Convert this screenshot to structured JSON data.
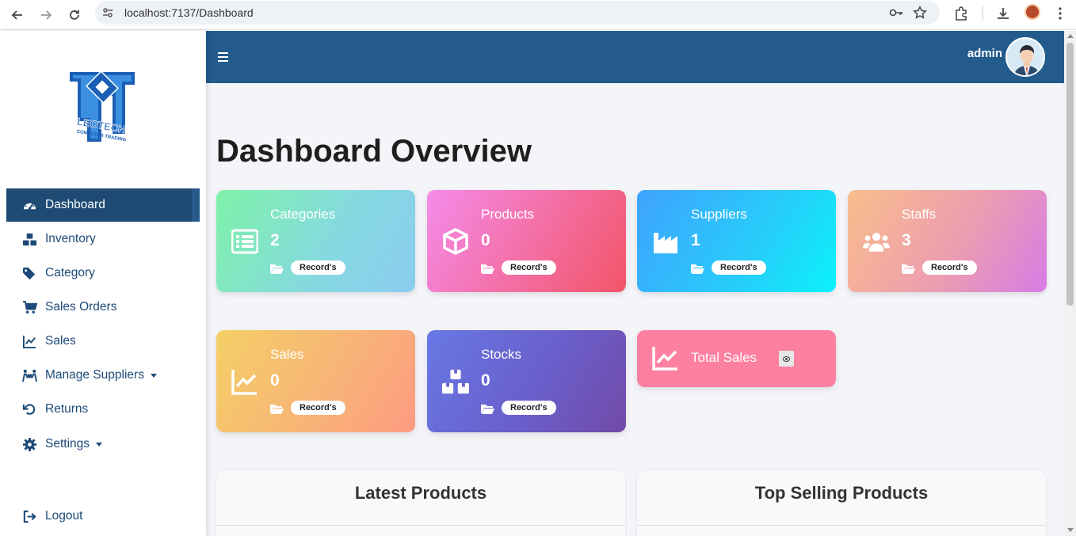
{
  "browser": {
    "url": "localhost:7137/Dashboard"
  },
  "sidebar": {
    "logo_text": "LEOTECH COMPUTER TRADING",
    "items": [
      {
        "label": "Dashboard",
        "icon": "gauge-icon",
        "active": true
      },
      {
        "label": "Inventory",
        "icon": "boxes-icon"
      },
      {
        "label": "Category",
        "icon": "tags-icon"
      },
      {
        "label": "Sales Orders",
        "icon": "cart-icon"
      },
      {
        "label": "Sales",
        "icon": "chart-line-icon"
      },
      {
        "label": "Manage Suppliers",
        "icon": "people-carry-icon",
        "dropdown": true
      },
      {
        "label": "Returns",
        "icon": "undo-icon"
      },
      {
        "label": "Settings",
        "icon": "gear-icon",
        "dropdown": true
      }
    ],
    "logout": {
      "label": "Logout",
      "icon": "sign-out-icon"
    }
  },
  "header": {
    "user": "admin"
  },
  "page": {
    "title": "Dashboard Overview"
  },
  "cards": [
    {
      "title": "Categories",
      "count": "2",
      "badge": "Record's",
      "icon": "list-icon",
      "color": "#86d8e2"
    },
    {
      "title": "Products",
      "count": "0",
      "badge": "Record's",
      "icon": "cube-icon",
      "color": "#f36b9b"
    },
    {
      "title": "Suppliers",
      "count": "1",
      "badge": "Record's",
      "icon": "industry-icon",
      "color": "#27cdfa"
    },
    {
      "title": "Staffs",
      "count": "3",
      "badge": "Record's",
      "icon": "users-icon",
      "color": "#ec9db0"
    },
    {
      "title": "Sales",
      "count": "0",
      "badge": "Record's",
      "icon": "chart-line-icon",
      "color": "#f7b477"
    },
    {
      "title": "Stocks",
      "count": "0",
      "badge": "Record's",
      "icon": "boxes-icon",
      "color": "#6a5fcb"
    }
  ],
  "total_sales": {
    "label": "Total Sales",
    "icon": "chart-line-icon",
    "toggle_icon": "eye-icon",
    "color": "#fd80a0"
  },
  "panels": [
    {
      "title": "Latest Products"
    },
    {
      "title": "Top Selling Products"
    }
  ],
  "colors": {
    "topbar": "#225b8c",
    "sidebar_active": "#1e4a73",
    "sidebar_text": "#1d4a78"
  }
}
